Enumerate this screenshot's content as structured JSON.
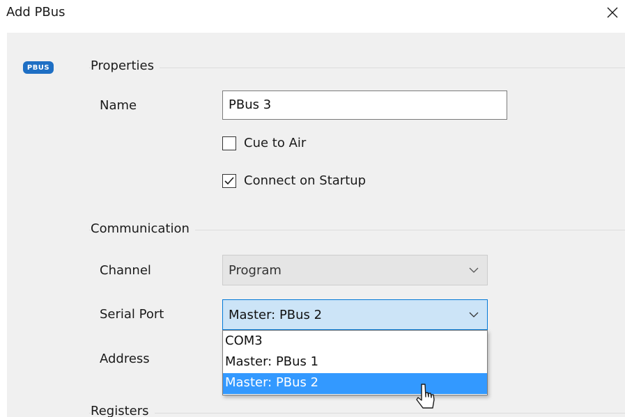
{
  "window": {
    "title": "Add PBus",
    "close_icon": "close-icon"
  },
  "badge": {
    "text": "PBUS",
    "color": "#1e6fc4"
  },
  "properties": {
    "section_label": "Properties",
    "name_label": "Name",
    "name_value": "PBus 3",
    "cue_to_air_label": "Cue to Air",
    "cue_to_air_checked": false,
    "connect_on_startup_label": "Connect on Startup",
    "connect_on_startup_checked": true
  },
  "communication": {
    "section_label": "Communication",
    "channel_label": "Channel",
    "channel_value": "Program",
    "serial_port_label": "Serial Port",
    "serial_port_value": "Master: PBus 2",
    "serial_port_options": [
      "COM3",
      "Master: PBus 1",
      "Master: PBus 2"
    ],
    "serial_port_selected_index": 2,
    "address_label": "Address"
  },
  "registers": {
    "section_label": "Registers"
  },
  "colors": {
    "selection": "#3399ff",
    "focus_border": "#0078d7",
    "focus_fill": "#cce4f7",
    "panel_background": "#f0f0f0"
  }
}
